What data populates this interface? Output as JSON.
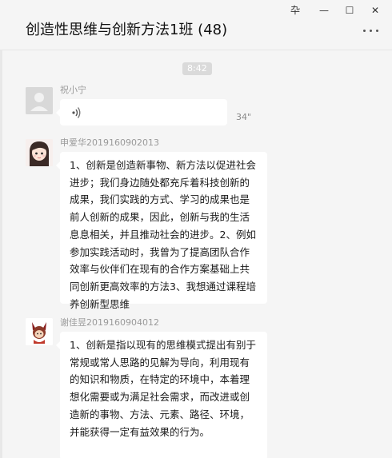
{
  "window": {
    "title": "创造性思维与创新方法1班 (48)",
    "controls": {
      "pin": "卆",
      "minimize": "—",
      "maximize": "☐",
      "close": "✕"
    }
  },
  "messages": [
    {
      "type": "time",
      "text": "8:42"
    },
    {
      "type": "voice",
      "sender": "祝小宁",
      "duration": "34\""
    },
    {
      "type": "text",
      "sender": "申爱华2019160902013",
      "text": "1、创新是创造新事物、新方法以促进社会进步；我们身边随处都充斥着科技创新的成果，我们实践的方式、学习的成果也是前人创新的成果，因此，创新与我的生活息息相关，并且推动社会的进步。2、例如参加实践活动时，我曾为了提高团队合作效率与伙伴们在现有的合作方案基础上共同创新更高效率的方法3、我想通过课程培养创新型思维"
    },
    {
      "type": "text",
      "sender": "谢佳昱2019160904012",
      "text": "1、创新是指以现有的思维模式提出有别于常规或常人思路的见解为导向，利用现有的知识和物质，在特定的环境中，本着理想化需要或为满足社会需求，而改进或创造新的事物、方法、元素、路径、环境，并能获得一定有益效果的行为。"
    }
  ]
}
